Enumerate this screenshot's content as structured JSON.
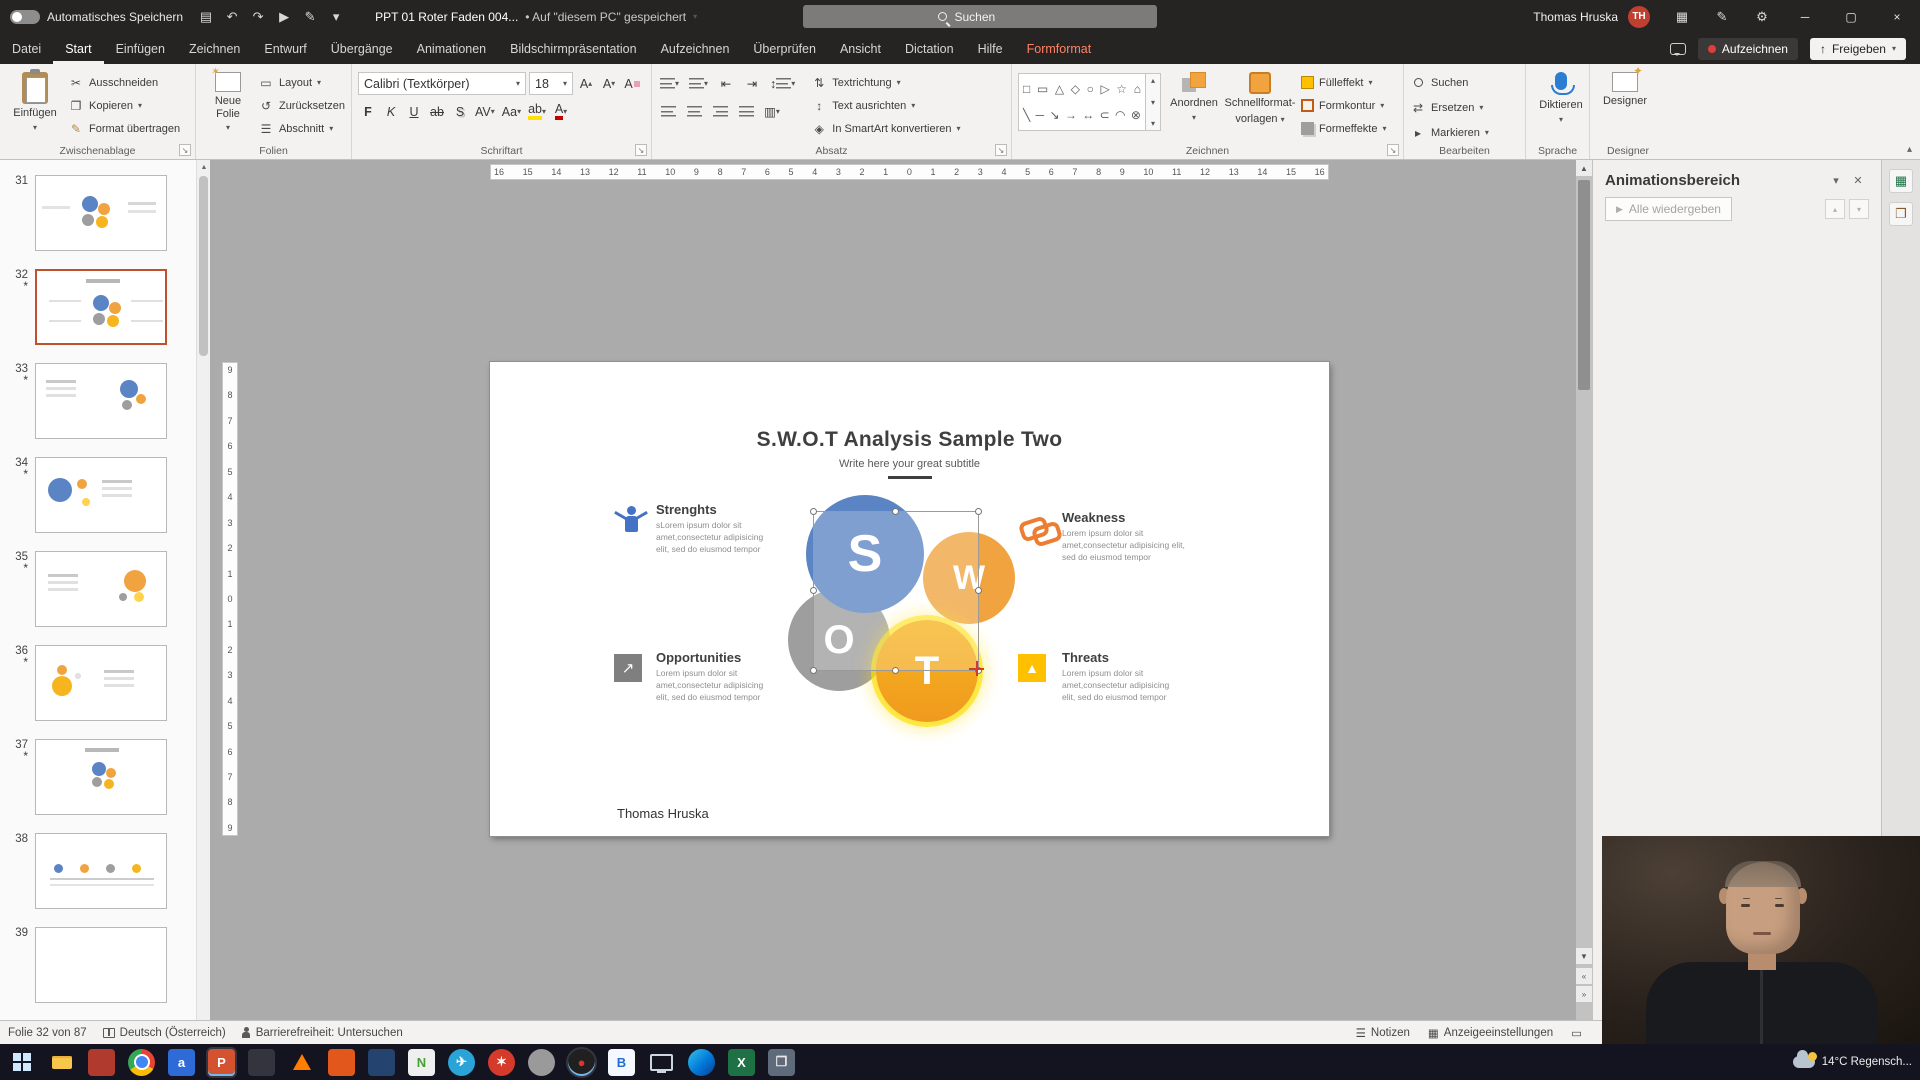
{
  "titlebar": {
    "autosave": "Automatisches Speichern",
    "filename": "PPT 01 Roter Faden 004...",
    "saved": "• Auf \"diesem PC\" gespeichert",
    "search": "Suchen",
    "user": "Thomas Hruska",
    "initials": "TH",
    "qat_icons": [
      {
        "name": "save-icon",
        "glyph": "▤"
      },
      {
        "name": "undo-icon",
        "glyph": "↶"
      },
      {
        "name": "redo-icon",
        "glyph": "↷"
      },
      {
        "name": "slideshow-from-start-icon",
        "glyph": "▶"
      },
      {
        "name": "ink-pen-icon",
        "glyph": "✎"
      },
      {
        "name": "customize-quick-access-icon",
        "glyph": "▾"
      }
    ],
    "right_icons": [
      {
        "name": "apps-grid-icon",
        "glyph": "▦"
      },
      {
        "name": "draw-pen-icon",
        "glyph": "✎"
      },
      {
        "name": "settings-gear-icon",
        "glyph": "⚙"
      }
    ],
    "window_controls": [
      {
        "name": "minimize-button",
        "glyph": "─"
      },
      {
        "name": "maximize-button",
        "glyph": "▢"
      },
      {
        "name": "close-button",
        "glyph": "×"
      }
    ]
  },
  "tabs": [
    {
      "name": "tab-datei",
      "label": "Datei"
    },
    {
      "name": "tab-start",
      "label": "Start",
      "cls": "selected"
    },
    {
      "name": "tab-einfuegen",
      "label": "Einfügen"
    },
    {
      "name": "tab-zeichnen",
      "label": "Zeichnen"
    },
    {
      "name": "tab-entwurf",
      "label": "Entwurf"
    },
    {
      "name": "tab-uebergaenge",
      "label": "Übergänge"
    },
    {
      "name": "tab-animationen",
      "label": "Animationen"
    },
    {
      "name": "tab-bildschirmpraesentation",
      "label": "Bildschirmpräsentation"
    },
    {
      "name": "tab-aufzeichnen",
      "label": "Aufzeichnen"
    },
    {
      "name": "tab-ueberpruefen",
      "label": "Überprüfen"
    },
    {
      "name": "tab-ansicht",
      "label": "Ansicht"
    },
    {
      "name": "tab-dictation",
      "label": "Dictation"
    },
    {
      "name": "tab-hilfe",
      "label": "Hilfe"
    },
    {
      "name": "tab-formformat",
      "label": "Formformat",
      "cls": "contextual"
    }
  ],
  "tab_actions": {
    "record": "Aufzeichnen",
    "share": "Freigeben"
  },
  "ribbon": {
    "clipboard": {
      "caption": "Zwischenablage",
      "paste": "Einfügen",
      "cut": "Ausschneiden",
      "copy": "Kopieren",
      "painter": "Format übertragen"
    },
    "slides": {
      "caption": "Folien",
      "new_slide": "Neue Folie",
      "layout": "Layout",
      "reset": "Zurücksetzen",
      "section": "Abschnitt"
    },
    "font": {
      "caption": "Schriftart",
      "family": "Calibri (Textkörper)",
      "size": "18",
      "bold": "F",
      "italic": "K",
      "underline": "U",
      "strike": "ab",
      "shadow": "S",
      "spacing": "AV",
      "case": "Aa",
      "grow": "A",
      "shrink": "A",
      "clear": "A",
      "highlight": "ab",
      "color": "A"
    },
    "paragraph": {
      "caption": "Absatz",
      "direction": "Textrichtung",
      "align": "Text ausrichten",
      "smartart": "In SmartArt konvertieren"
    },
    "drawing": {
      "caption": "Zeichnen",
      "arrange": "Anordnen",
      "quick1": "Schnellformat-",
      "quick2": "vorlagen",
      "fill": "Fülleffekt",
      "outline": "Formkontur",
      "effects": "Formeffekte",
      "shapes_row1": [
        "□",
        "▭",
        "△",
        "◇",
        "○",
        "▷",
        "☆",
        "⌂"
      ],
      "shapes_row2": [
        "╲",
        "─",
        "↘",
        "→",
        "↔",
        "⊂",
        "◠",
        "⊗"
      ]
    },
    "editing": {
      "caption": "Bearbeiten",
      "find": "Suchen",
      "replace": "Ersetzen",
      "select": "Markieren"
    },
    "voice": {
      "caption": "Sprache",
      "dictate": "Diktieren"
    },
    "designer": {
      "caption": "Designer",
      "button": "Designer"
    }
  },
  "icons": {
    "chevron_down": "▾",
    "chevron_up": "▴",
    "scissors": "✂",
    "copy": "❐",
    "painter": "✎",
    "layout": "▭",
    "reset": "↺",
    "section": "☰",
    "replace": "⇄",
    "select": "▸",
    "outdent": "⇤",
    "indent": "⇥",
    "spacing": "↕",
    "columns": "▥",
    "direction": "⇅",
    "align_text": "↕",
    "smartart": "◈",
    "up_arrow": "↑",
    "opp_arrow": "↗",
    "warn_triangle": "▲",
    "play": "▶",
    "pane_green": "▦",
    "pane_clip": "❐",
    "scroll_up": "▲",
    "scroll_down": "▼",
    "prev_slide": "«",
    "next_slide": "»",
    "notes": "☰",
    "display": "▦",
    "view_normal": "▭"
  },
  "thumbs": [
    {
      "name": "slide-thumb-31",
      "num": "31",
      "star": "",
      "cls": "kind-a"
    },
    {
      "name": "slide-thumb-32",
      "num": "32",
      "star": "*",
      "cls": "kind-b selected"
    },
    {
      "name": "slide-thumb-33",
      "num": "33",
      "star": "*",
      "cls": "kind-c"
    },
    {
      "name": "slide-thumb-34",
      "num": "34",
      "star": "*",
      "cls": "kind-d"
    },
    {
      "name": "slide-thumb-35",
      "num": "35",
      "star": "*",
      "cls": "kind-e"
    },
    {
      "name": "slide-thumb-36",
      "num": "36",
      "star": "*",
      "cls": "kind-f"
    },
    {
      "name": "slide-thumb-37",
      "num": "37",
      "star": "*",
      "cls": "kind-g"
    },
    {
      "name": "slide-thumb-38",
      "num": "38",
      "star": "",
      "cls": "kind-h"
    },
    {
      "name": "slide-thumb-39",
      "num": "39",
      "star": "",
      "cls": "kind-blank"
    }
  ],
  "rulers": {
    "h": [
      "16",
      "15",
      "14",
      "13",
      "12",
      "11",
      "10",
      "9",
      "8",
      "7",
      "6",
      "5",
      "4",
      "3",
      "2",
      "1",
      "0",
      "1",
      "2",
      "3",
      "4",
      "5",
      "6",
      "7",
      "8",
      "9",
      "10",
      "11",
      "12",
      "13",
      "14",
      "15",
      "16"
    ],
    "v": [
      "9",
      "8",
      "7",
      "6",
      "5",
      "4",
      "3",
      "2",
      "1",
      "0",
      "1",
      "2",
      "3",
      "4",
      "5",
      "6",
      "7",
      "8",
      "9"
    ]
  },
  "slide": {
    "title": "S.W.O.T Analysis Sample Two",
    "subtitle": "Write here your great subtitle",
    "letters": {
      "s": "S",
      "w": "W",
      "o": "O",
      "t": "T"
    },
    "strengths": {
      "title": "Strenghts",
      "body": "sLorem ipsum dolor sit amet,consectetur adipisicing elit, sed do eiusmod tempor"
    },
    "weakness": {
      "title": "Weakness",
      "body": "Lorem ipsum dolor sit amet,consectetur adipisicing elit, sed do eiusmod tempor"
    },
    "opportunities": {
      "title": "Opportunities",
      "body": "Lorem ipsum dolor sit amet,consectetur adipisicing elit, sed do eiusmod tempor"
    },
    "threats": {
      "title": "Threats",
      "body": "Lorem ipsum dolor sit amet,consectetur adipisicing elit, sed do eiusmod tempor"
    },
    "author": "Thomas Hruska"
  },
  "animation_pane": {
    "title": "Animationsbereich",
    "play_all": "Alle wiedergeben"
  },
  "status": {
    "slide": "Folie 32 von 87",
    "language": "Deutsch (Österreich)",
    "accessibility": "Barrierefreiheit: Untersuchen",
    "notes": "Notizen",
    "display": "Anzeigeeinstellungen"
  },
  "taskbar": {
    "weather": "14°C Regensch...",
    "icons": [
      {
        "name": "taskbar-start",
        "cls": "k-start",
        "glyph": ""
      },
      {
        "name": "taskbar-file-explorer",
        "cls": "k-folder",
        "glyph": ""
      },
      {
        "name": "taskbar-app-red",
        "glyph": "",
        "bg": "#b03a2e"
      },
      {
        "name": "ta skbar-chrome",
        "cls": "k-chrome",
        "glyph": ""
      },
      {
        "name": "taskbar-app-a",
        "glyph": "a",
        "bg": "#2e6bd6",
        "fg": "#ffffff"
      },
      {
        "name": "taskbar-powerpoint",
        "glyph": "P",
        "bg": "#d35230",
        "fg": "#ffffff",
        "cls": "active"
      },
      {
        "name": "taskbar-app-dark",
        "glyph": "",
        "bg": "#34343f"
      },
      {
        "name": "taskbar-vlc",
        "cls": "k-vlc",
        "glyph": ""
      },
      {
        "name": "taskbar-app-orange",
        "glyph": "",
        "bg": "#e2571b"
      },
      {
        "name": "taskbar-app-navy",
        "glyph": "",
        "bg": "#24436e"
      },
      {
        "name": "taskbar-notepad",
        "glyph": "N",
        "bg": "#efefef",
        "fg": "#44a033"
      },
      {
        "name": "taskbar-telegram",
        "glyph": "✈",
        "bg": "#29a3d8",
        "fg": "#ffffff",
        "cls": "round"
      },
      {
        "name": "taskbar-app-flame",
        "glyph": "✶",
        "bg": "#d63a2a",
        "fg": "#ffffff",
        "cls": "round"
      },
      {
        "name": "taskbar-app-gray",
        "glyph": "",
        "bg": "#9a9a9a",
        "cls": "round"
      },
      {
        "name": "taskbar-recorder",
        "glyph": "●",
        "bg": "#202020",
        "fg": "#e03131",
        "cls": "round active"
      },
      {
        "name": "taskbar-app-blue-b",
        "glyph": "B",
        "bg": "#f5f8ff",
        "fg": "#1f6fd0"
      },
      {
        "name": "taskbar-remote-monitor",
        "cls": "k-monitor",
        "glyph": ""
      },
      {
        "name": "taskbar-edge",
        "cls": "k-edge",
        "glyph": ""
      },
      {
        "name": "taskbar-excel",
        "glyph": "X",
        "bg": "#1e7145",
        "fg": "#ffffff"
      },
      {
        "name": "taskbar-app-window",
        "glyph": "❐",
        "bg": "#5f6b7a",
        "fg": "#e8e8e8"
      }
    ]
  }
}
